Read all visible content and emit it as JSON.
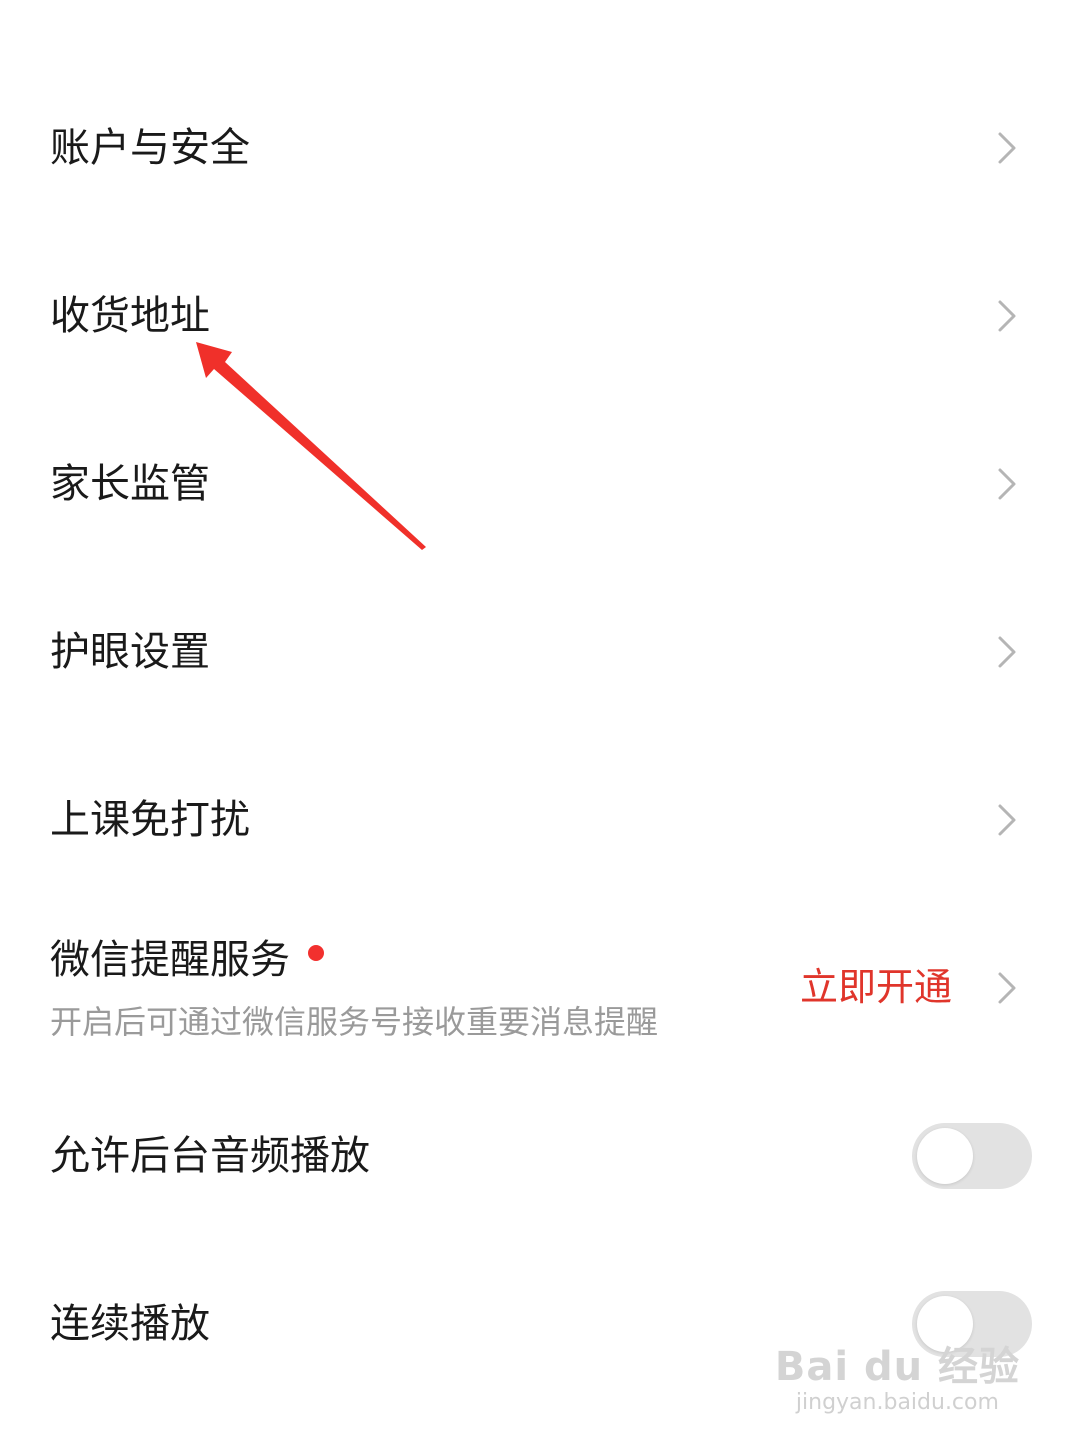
{
  "settings": {
    "items": [
      {
        "label": "账户与安全"
      },
      {
        "label": "收货地址"
      },
      {
        "label": "家长监管"
      },
      {
        "label": "护眼设置"
      },
      {
        "label": "上课免打扰"
      }
    ],
    "wechat": {
      "label": "微信提醒服务",
      "description": "开启后可通过微信服务号接收重要消息提醒",
      "action": "立即开通"
    },
    "toggles": [
      {
        "label": "允许后台音频播放",
        "on": false
      },
      {
        "label": "连续播放",
        "on": false
      }
    ]
  },
  "colors": {
    "action": "#e0352b",
    "badge": "#f2302e",
    "annotation_arrow": "#f0302a",
    "toggle_off": "#e2e2e2",
    "chevron": "#b5b5b5"
  },
  "watermark": {
    "main": "Bai du 经验",
    "url": "jingyan.baidu.com"
  }
}
